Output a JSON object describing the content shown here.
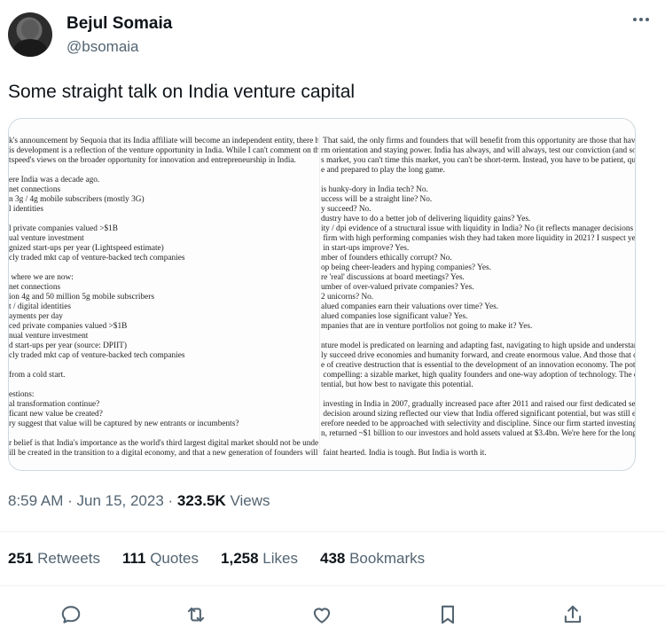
{
  "author": {
    "name": "Bejul Somaia",
    "handle": "@bsomaia"
  },
  "tweet": {
    "text": "Some straight talk on India venture capital"
  },
  "document": {
    "left": [
      "k's announcement by Sequoia that its India affiliate will become an independent entity, there has b",
      "is development is a reflection of the venture opportunity in India. While I can't comment on their d",
      "tspeed's views on the broader opportunity for innovation and entrepreneurship in India.",
      "",
      "ere India was a decade ago.",
      "net connections",
      "n 3g / 4g mobile subscribers (mostly 3G)",
      "l identities",
      "",
      "l private companies valued >$1B",
      "ual venture investment",
      "gnized start-ups per year (Lightspeed estimate)",
      "cly traded mkt cap of venture-backed tech companies",
      "",
      " where we are now:",
      "net connections",
      "ion 4g and 50 million 5g mobile subscribers",
      "t / digital identities",
      "ayments per day",
      "ced private companies valued >$1B",
      "nual venture investment",
      "d start-ups per year (source: DPIIT)",
      "cly traded mkt cap of venture-backed tech companies",
      "",
      "from a cold start.",
      "",
      "estions:",
      "al transformation continue?",
      "ficant new value be created?",
      "ry suggest that value will be captured by new entrants or incumbents?",
      "",
      "r belief is that India's importance as the world's third largest digital market should not be under-est",
      "ill be created in the transition to a digital economy, and that a new generation of founders will be c"
    ],
    "right": [
      " That said, the only firms and founders that will benefit from this opportunity are those that have",
      "rm orientation and staying power. India has always, and will always, test our conviction (and so",
      "s market, you can't time this market, you can't be short-term. Instead, you have to be patient, qu",
      "e and prepared to play the long game.",
      "",
      "is hunky-dory in India tech? No.",
      "uccess will be a straight line? No.",
      "y succeed? No.",
      "dustry have to do a better job of delivering liquidity gains? Yes.",
      "ity / dpi evidence of a structural issue with liquidity in India? No (it reflects manager decisions",
      " firm with high performing companies wish they had taken more liquidity in 2021? I suspect ye",
      " in start-ups improve? Yes.",
      "mber of founders ethically corrupt? No.",
      "op being cheer-leaders and hyping companies? Yes.",
      "re 'real' discussions at board meetings? Yes.",
      "umber of over-valued private companies? Yes.",
      "2 unicorns? No.",
      "alued companies earn their valuations over time? Yes.",
      "alued companies lose significant value? Yes.",
      "mpanies that are in venture portfolios not going to make it? Yes.",
      "",
      "nture model is predicated on learning and adapting fast, navigating to high upside and understan",
      "ly succeed drive economies and humanity forward, and create enormous value. And those that d",
      "e of creative destruction that is essential to the development of an innovation economy. The pot",
      " compelling: a sizable market, high quality founders and one-way adoption of technology. The q",
      "tential, but how best to navigate this potential.",
      "",
      " investing in India in 2007, gradually increased pace after 2011 and raised our first dedicated set",
      " decision around sizing reflected our view that India offered significant potential, but was still e",
      "erefore needed to be approached with selectivity and discipline. Since our firm started investing",
      "n, returned ~$1 billion to our investors and hold assets valued at $3.4bn. We're here for the long",
      "",
      " faint hearted. India is tough. But India is worth it."
    ]
  },
  "meta": {
    "time": "8:59 AM",
    "dot1": " · ",
    "date": "Jun 15, 2023",
    "dot2": " · ",
    "views_count": "323.5K",
    "views_label": " Views"
  },
  "stats": {
    "retweets": {
      "count": "251",
      "label": " Retweets"
    },
    "quotes": {
      "count": "111",
      "label": " Quotes"
    },
    "likes": {
      "count": "1,258",
      "label": " Likes"
    },
    "bookmarks": {
      "count": "438",
      "label": " Bookmarks"
    }
  },
  "actions": [
    "reply-icon",
    "retweet-icon",
    "like-icon",
    "bookmark-icon",
    "share-icon"
  ],
  "colors": {
    "text": "#0f1419",
    "secondary": "#536471",
    "border": "#cfd9de",
    "divider": "#eff3f4"
  }
}
